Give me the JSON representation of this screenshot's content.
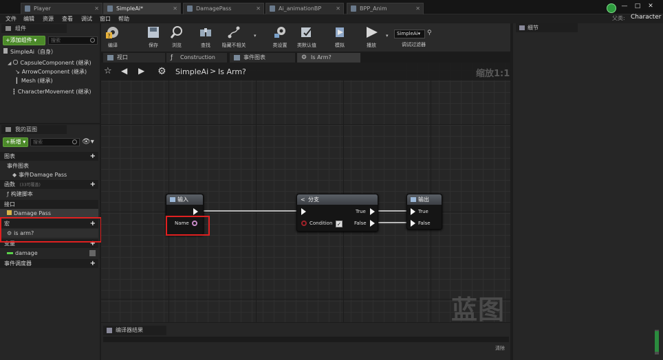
{
  "tabs": [
    {
      "label": "Player",
      "active": false
    },
    {
      "label": "SimpleAi*",
      "active": true
    },
    {
      "label": "DamagePass",
      "active": false
    },
    {
      "label": "Ai_animationBP",
      "active": false
    },
    {
      "label": "BPP_Anim",
      "active": false
    }
  ],
  "window_controls": {
    "minimize": "—",
    "maximize": "□",
    "close": "✕"
  },
  "menu": [
    "文件",
    "编辑",
    "资源",
    "查看",
    "调试",
    "窗口",
    "帮助"
  ],
  "parent_class": {
    "label": "父类:",
    "value": "Character"
  },
  "components": {
    "title": "组件",
    "add_button": "+添加组件 ▾",
    "search_placeholder": "搜索",
    "self_item": "SimpleAi（自身）",
    "items": [
      "CapsuleComponent (继承)",
      "ArrowComponent (继承)",
      "Mesh (继承)",
      "CharacterMovement (继承)"
    ]
  },
  "my_blueprint": {
    "title": "我的蓝图",
    "new_button": "+新增 ▾",
    "search_placeholder": "搜索",
    "sections": {
      "graphs": "图表",
      "event_graph": "事件图表",
      "event_item": "事件Damage Pass",
      "functions": "函数",
      "functions_hint": "(33可覆盖)",
      "construction": "构建脚本",
      "interfaces": "接口",
      "interface_item": "Damage Pass",
      "macros": "宏",
      "macro_item": "is arm?",
      "variables": "变量",
      "variable_item": "damage",
      "dispatchers": "事件调度器"
    }
  },
  "toolbar": [
    {
      "label": "编译",
      "icon": "compile-icon"
    },
    {
      "label": "保存",
      "icon": "save-icon"
    },
    {
      "label": "浏览",
      "icon": "browse-icon"
    },
    {
      "label": "查找",
      "icon": "find-icon"
    },
    {
      "label": "隐藏不相关",
      "icon": "hide-unrelated-icon"
    },
    {
      "label": "类设置",
      "icon": "class-settings-icon"
    },
    {
      "label": "类默认值",
      "icon": "class-defaults-icon"
    },
    {
      "label": "模拟",
      "icon": "simulate-icon"
    },
    {
      "label": "播放",
      "icon": "play-icon"
    }
  ],
  "debug_filter": {
    "value": "SimpleAi▾",
    "label": "调试过滤器"
  },
  "graph_tabs": [
    {
      "label": "视口",
      "active": false
    },
    {
      "label": "Construction Scrip",
      "active": false
    },
    {
      "label": "事件图表",
      "active": false
    },
    {
      "label": "Is Arm?",
      "active": true
    }
  ],
  "breadcrumb": {
    "blueprint": "SimpleAi",
    "separator": ">",
    "graph": "Is Arm?"
  },
  "zoom": "缩放1:1",
  "watermark": "蓝图",
  "nodes": {
    "input": {
      "title": "输入",
      "pin_name": "Name"
    },
    "branch": {
      "title": "分支",
      "condition": "Condition",
      "true_label": "True",
      "false_label": "False"
    },
    "output": {
      "title": "输出",
      "true_label": "True",
      "false_label": "False"
    }
  },
  "compiler": {
    "title": "编译器结果",
    "clear": "清除"
  },
  "details": {
    "title": "细节"
  }
}
